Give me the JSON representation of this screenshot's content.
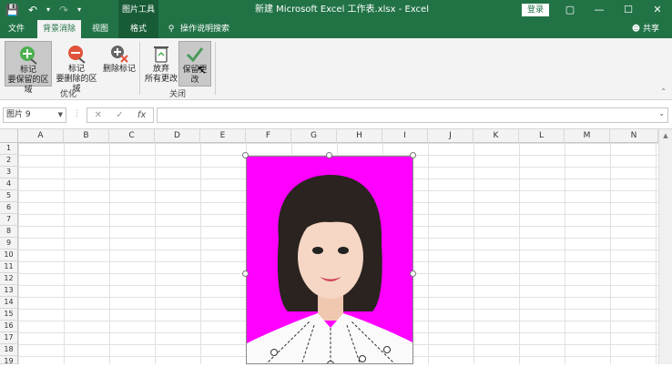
{
  "titlebar": {
    "context_group": "图片工具",
    "window_title": "新建 Microsoft Excel 工作表.xlsx  -  Excel",
    "login_label": "登录"
  },
  "tabs": [
    {
      "label": "文件"
    },
    {
      "label": "背景消除"
    },
    {
      "label": "视图"
    },
    {
      "label": "格式"
    },
    {
      "label": "操作说明搜索"
    }
  ],
  "share_label": "共享",
  "ribbon": {
    "optimize_group": {
      "label": "优化",
      "buttons": [
        {
          "label_line1": "标记",
          "label_line2": "要保留的区域"
        },
        {
          "label_line1": "标记",
          "label_line2": "要删除的区域"
        },
        {
          "label_line1": "删除标记",
          "label_line2": ""
        }
      ]
    },
    "close_group": {
      "label": "关闭",
      "buttons": [
        {
          "label_line1": "放弃",
          "label_line2": "所有更改"
        },
        {
          "label_line1": "保留更改",
          "label_line2": ""
        }
      ]
    }
  },
  "formula_bar": {
    "name_box": "图片 9",
    "cancel": "✕",
    "enter": "✓",
    "fx": "fx",
    "value": ""
  },
  "columns": [
    "A",
    "B",
    "C",
    "D",
    "E",
    "F",
    "G",
    "H",
    "I",
    "J",
    "K",
    "L",
    "M",
    "N"
  ],
  "rows": [
    "1",
    "2",
    "3",
    "4",
    "5",
    "6",
    "7",
    "8",
    "9",
    "10",
    "11",
    "12",
    "13",
    "14",
    "15",
    "16",
    "17",
    "18",
    "19"
  ],
  "colors": {
    "excel_green": "#217346",
    "background_removal_magenta": "#ff00ff"
  }
}
